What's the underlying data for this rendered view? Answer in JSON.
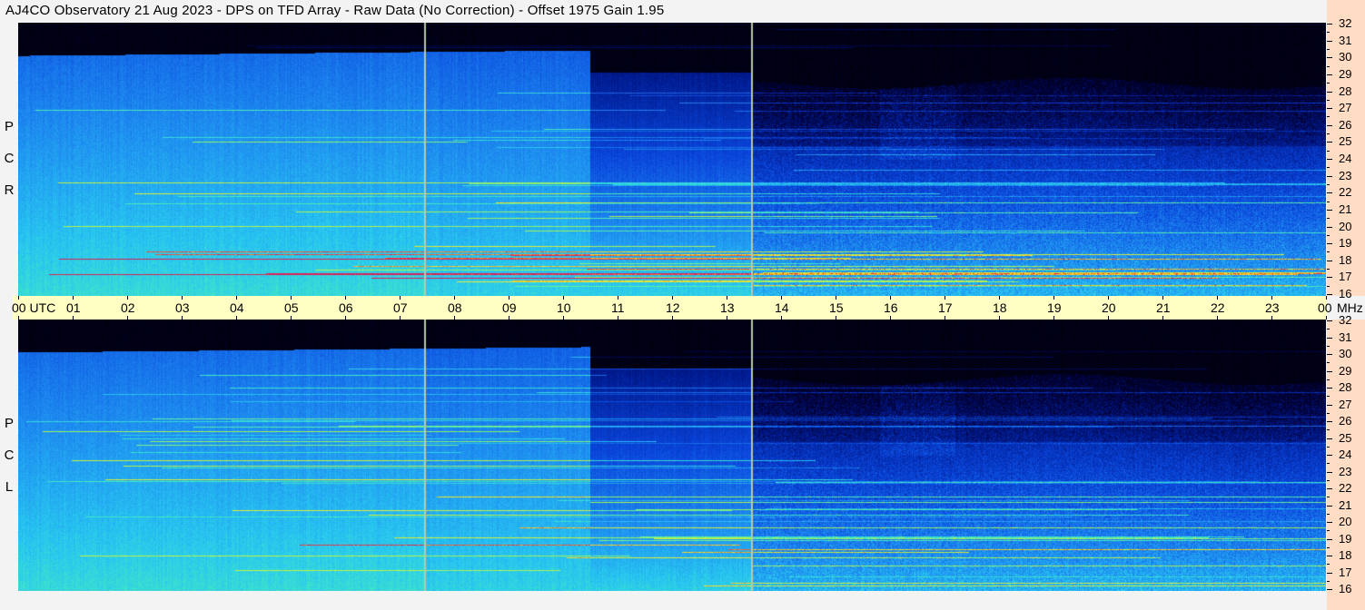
{
  "title": "AJ4CO Observatory  21 Aug 2023  -  DPS on TFD Array  -  Raw Data (No Correction)  -  Offset 1975  Gain 1.95",
  "panels": [
    {
      "id": "rcp",
      "polarization": [
        "R",
        "C",
        "P"
      ]
    },
    {
      "id": "lcp",
      "polarization": [
        "L",
        "C",
        "P"
      ]
    }
  ],
  "time_axis": {
    "labels": [
      "00 UTC",
      "01",
      "02",
      "03",
      "04",
      "05",
      "06",
      "07",
      "08",
      "09",
      "10",
      "11",
      "12",
      "13",
      "14",
      "15",
      "16",
      "17",
      "18",
      "19",
      "20",
      "21",
      "22",
      "23",
      "00"
    ],
    "unit": "MHz"
  },
  "freq_axis": {
    "labels": [
      "32",
      "31",
      "30",
      "29",
      "28",
      "27",
      "26",
      "25",
      "24",
      "23",
      "22",
      "21",
      "20",
      "19",
      "18",
      "17",
      "16"
    ]
  },
  "colors": {
    "background": "#f3f3f3",
    "time_axis_bg": "#ffffc4",
    "freq_axis_bg": "#ffdcc4",
    "plot_bg": "#000000",
    "marker_line": "#b8c8a8"
  },
  "chart_data": {
    "type": "heatmap",
    "title": "AJ4CO Observatory  21 Aug 2023  -  DPS on TFD Array  -  Raw Data (No Correction)  -  Offset 1975  Gain 1.95",
    "panels": [
      "R C P",
      "L C P"
    ],
    "x": {
      "label": "UTC",
      "range_hours": [
        0,
        24
      ],
      "ticks": [
        "00",
        "01",
        "02",
        "03",
        "04",
        "05",
        "06",
        "07",
        "08",
        "09",
        "10",
        "11",
        "12",
        "13",
        "14",
        "15",
        "16",
        "17",
        "18",
        "19",
        "20",
        "21",
        "22",
        "23",
        "00"
      ]
    },
    "y": {
      "label": "MHz",
      "range": [
        16,
        32
      ],
      "ticks": [
        32,
        31,
        30,
        29,
        28,
        27,
        26,
        25,
        24,
        23,
        22,
        21,
        20,
        19,
        18,
        17,
        16
      ]
    },
    "marker_lines_utc": [
      7.45,
      13.45
    ],
    "colormap": "black-blue-cyan-green-yellow-red"
  }
}
